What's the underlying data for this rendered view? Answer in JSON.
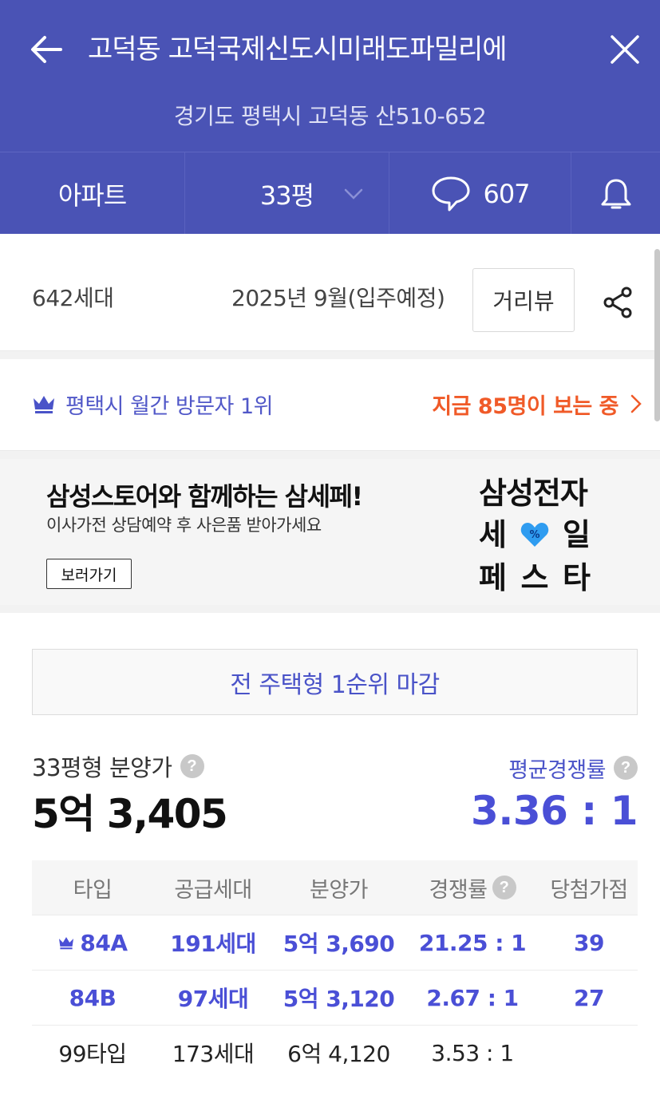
{
  "header": {
    "title": "고덕동 고덕국제신도시미래도파밀리에",
    "address": "경기도 평택시 고덕동 산510-652",
    "back_icon": "arrow-left-icon",
    "close_icon": "close-icon",
    "bg_color": "#4a53b5"
  },
  "tabs": {
    "type_label": "아파트",
    "size_label": "33평",
    "comment_count": "607",
    "alarm_icon": "bell-icon"
  },
  "info": {
    "households": "642세대",
    "move_in": "2025년 9월(입주예정)",
    "street_view_label": "거리뷰",
    "share_icon": "share-icon"
  },
  "visitor_banner": {
    "rank_text": "평택시 월간 방문자 1위",
    "viewers_text": "지금 85명이 보는 중",
    "rank_color": "#5158c8",
    "viewers_color": "#f05a28"
  },
  "ad": {
    "title": "삼성스토어와 함께하는 삼세페!",
    "subtitle": "이사가전 상담예약 후 사은품 받아가세요",
    "button_label": "보러가기",
    "logo_line1": "삼성전자",
    "logo_row2_left": "세",
    "logo_row2_right": "일",
    "logo_heart_text": "%",
    "logo_row3_a": "페",
    "logo_row3_b": "스",
    "logo_row3_c": "타"
  },
  "notice": {
    "closed_text": "전 주택형 1순위 마감"
  },
  "price": {
    "label": "33평형 분양가",
    "value": "5억 3,405",
    "help": "?"
  },
  "competition": {
    "label": "평균경쟁률",
    "value": "3.36 : 1",
    "color": "#4a4fd6"
  },
  "table": {
    "headers": [
      "타입",
      "공급세대",
      "분양가",
      "경쟁률",
      "당첨가점"
    ],
    "rows": [
      {
        "type": "84A",
        "supply": "191세대",
        "price": "5억 3,690",
        "ratio": "21.25 : 1",
        "score": "39",
        "crown": true
      },
      {
        "type": "84B",
        "supply": "97세대",
        "price": "5억 3,120",
        "ratio": "2.67 : 1",
        "score": "27"
      },
      {
        "type": "99타입",
        "supply": "173세대",
        "price": "6억 4,120",
        "ratio": "3.53 : 1",
        "score": ""
      }
    ]
  }
}
